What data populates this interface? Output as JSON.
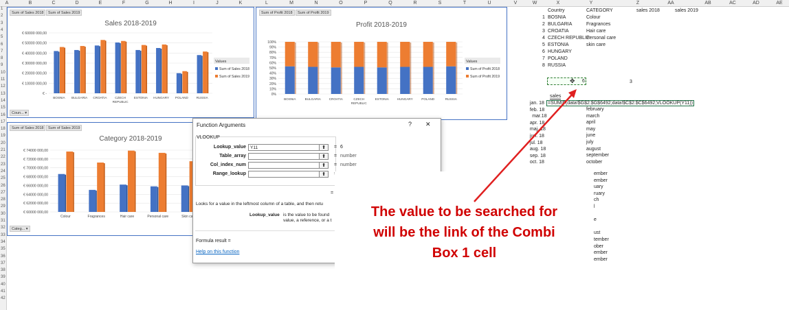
{
  "columns": [
    "A",
    "B",
    "C",
    "D",
    "E",
    "F",
    "G",
    "H",
    "I",
    "J",
    "K",
    "L",
    "M",
    "N",
    "O",
    "P",
    "Q",
    "R",
    "S",
    "T",
    "U",
    "V",
    "W",
    "X",
    "Y",
    "Z",
    "AA",
    "AB",
    "AC",
    "AD",
    "AE"
  ],
  "colors": {
    "blue": "#4472c4",
    "orange": "#ed7d31",
    "annotation_red": "#d00000",
    "dialog_border": "#999999"
  },
  "sales_chart": {
    "buttons": [
      "Sum of Sales 2018",
      "Sum of Sales 2019"
    ],
    "filter_button": "Coun...",
    "chart_data": {
      "type": "bar",
      "title": "Sales 2018-2019",
      "categories": [
        "BOSNIA",
        "BULGARIA",
        "CROATIA",
        "CZECH REPUBLIC",
        "ESTONIA",
        "HUNGARY",
        "POLAND",
        "RUSSIA"
      ],
      "series": [
        {
          "name": "Sum of Sales 2018",
          "values": [
            42000000,
            43000000,
            47500000,
            50500000,
            43000000,
            45000000,
            20000000,
            38000000
          ]
        },
        {
          "name": "Sum of Sales 2019",
          "values": [
            46000000,
            47000000,
            53000000,
            52000000,
            48000000,
            48500000,
            22000000,
            41500000
          ]
        }
      ],
      "yticks": [
        "€ 60000 000,00",
        "€ 50000 000,00",
        "€ 40000 000,00",
        "€ 30000 000,00",
        "€ 20000 000,00",
        "€ 10000 000,00",
        "€ -"
      ],
      "ylim": [
        0,
        60000000
      ],
      "legend_title": "Values",
      "legend_placement": "right"
    }
  },
  "profit_chart": {
    "buttons": [
      "Sum of Profit 2018",
      "Sum of Profit 2019"
    ],
    "chart_data": {
      "type": "bar",
      "stacked": "percent",
      "title": "Profit 2018-2019",
      "categories": [
        "BOSNIA",
        "BULGARIA",
        "CROATIA",
        "CZECH REPUBLIC",
        "ESTONIA",
        "HUNGARY",
        "POLAND",
        "RUSSIA"
      ],
      "series": [
        {
          "name": "Sum of Profit 2018",
          "values": [
            53,
            52,
            51,
            52,
            51,
            52,
            52,
            53
          ]
        },
        {
          "name": "Sum of Profit 2019",
          "values": [
            47,
            48,
            49,
            48,
            49,
            48,
            48,
            47
          ]
        }
      ],
      "yticks": [
        "100%",
        "90%",
        "80%",
        "70%",
        "60%",
        "50%",
        "40%",
        "30%",
        "20%",
        "10%",
        "0%"
      ],
      "ylim": [
        0,
        100
      ],
      "legend_title": "Values",
      "legend_placement": "right"
    }
  },
  "category_chart": {
    "buttons": [
      "Sum of Sales 2018",
      "Sum of Sales 2019"
    ],
    "filter_button": "Categ...",
    "chart_data": {
      "type": "bar",
      "title": "Category 2018-2019",
      "categories": [
        "Colour",
        "Fragrances",
        "Hair care",
        "Personal care",
        "Skin care"
      ],
      "series": [
        {
          "values": [
            68600000,
            65000000,
            66200000,
            65800000,
            66000000
          ]
        },
        {
          "values": [
            73700000,
            71200000,
            73900000,
            73400000,
            71500000
          ]
        }
      ],
      "yticks": [
        "€ 74000 000,00",
        "€ 72000 000,00",
        "€ 70000 000,00",
        "€ 68000 000,00",
        "€ 66000 000,00",
        "€ 64000 000,00",
        "€ 62000 000,00",
        "€ 60000 000,00"
      ],
      "ylim": [
        60000000,
        74000000
      ]
    }
  },
  "sheet": {
    "headers": {
      "country": "Country",
      "category": "CATEGORY",
      "sales2018": "sales 2018",
      "sales2019": "sales 2019"
    },
    "countries": [
      {
        "n": "1",
        "name": "BOSNIA"
      },
      {
        "n": "2",
        "name": "BULGARIA"
      },
      {
        "n": "3",
        "name": "CROATIA"
      },
      {
        "n": "4",
        "name": "CZECH REPUBLIC"
      },
      {
        "n": "5",
        "name": "ESTONIA"
      },
      {
        "n": "6",
        "name": "HUNGARY"
      },
      {
        "n": "7",
        "name": "POLAND"
      },
      {
        "n": "8",
        "name": "RUSSIA"
      }
    ],
    "categories": [
      "Colour",
      "Fragrances",
      "Hair care",
      "Personal care",
      "skin care"
    ],
    "combo_value": "6",
    "z_value": "3",
    "sales_label": "sales",
    "formula": "=SUMIF(data!$G$2:$G$6492;data!$C$2:$C$6492;VLOOKUP(Y11))",
    "dates": [
      "jan. 18",
      "feb. 18",
      "mar.18",
      "apr. 18",
      "maj. 18",
      "jun. 18",
      "jul. 18",
      "aug. 18",
      "sep. 18",
      "oct. 18"
    ],
    "months": [
      "february",
      "march",
      "april",
      "may",
      "june",
      "july",
      "august",
      "september",
      "october"
    ],
    "partial_months": [
      "ember",
      "ember",
      "uary",
      "ruary",
      "ch",
      "l",
      "",
      "e",
      "",
      "ust",
      "tember",
      "ober",
      "ember",
      "ember"
    ]
  },
  "dialog": {
    "title": "Function Arguments",
    "help_icon": "?",
    "close_icon": "✕",
    "function": "VLOOKUP",
    "args": [
      {
        "label": "Lookup_value",
        "value": "Y11",
        "result": "6"
      },
      {
        "label": "Table_array",
        "value": "",
        "result": "number"
      },
      {
        "label": "Col_index_num",
        "value": "",
        "result": "number"
      },
      {
        "label": "Range_lookup",
        "value": "",
        "result": ""
      }
    ],
    "description": "Looks for a value in the leftmost column of a table, and then retu",
    "detail_label": "Lookup_value",
    "detail_line1": "is the value to be found",
    "detail_line2": "value, a reference, or a t",
    "formula_result": "Formula result =",
    "help_link": "Help on this function",
    "partial_eq": "="
  },
  "annotation": {
    "text_line1": "The value to be searched for",
    "text_line2": "will be the link of the Combi",
    "text_line3": "Box 1 cell"
  }
}
